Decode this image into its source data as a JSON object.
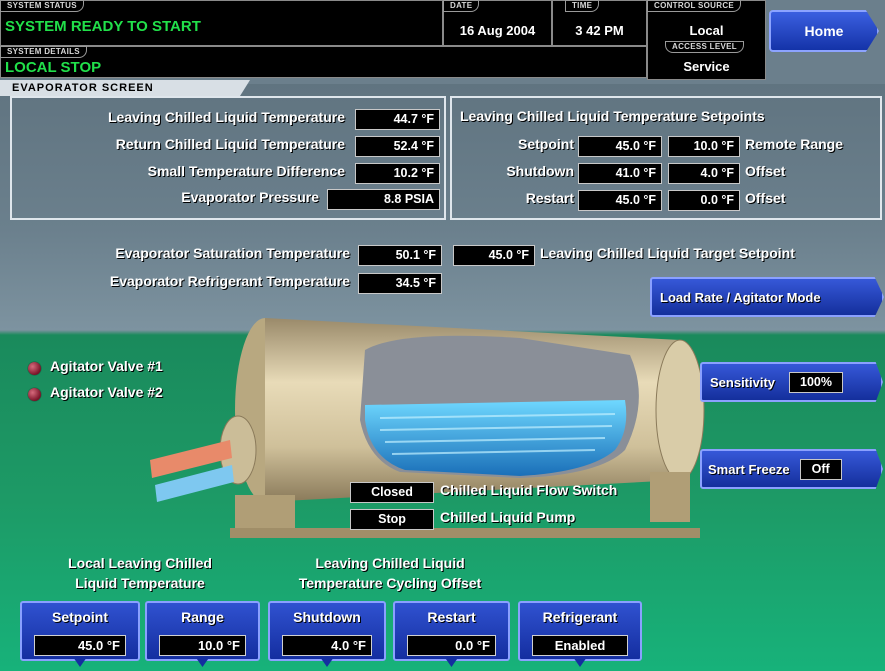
{
  "header": {
    "system_status_tab": "SYSTEM STATUS",
    "system_status": "SYSTEM READY TO START",
    "system_details_tab": "SYSTEM DETAILS",
    "system_details": "LOCAL STOP",
    "date_tab": "DATE",
    "date": "16 Aug 2004",
    "time_tab": "TIME",
    "time": "3 42 PM",
    "control_source_tab": "CONTROL SOURCE",
    "control_source": "Local",
    "access_level_tab": "ACCESS LEVEL",
    "access_level": "Service",
    "home_label": "Home"
  },
  "screen_title": "EVAPORATOR SCREEN",
  "left_panel": {
    "rows": [
      {
        "label": "Leaving Chilled Liquid Temperature",
        "value": "44.7 °F"
      },
      {
        "label": "Return Chilled Liquid Temperature",
        "value": "52.4 °F"
      },
      {
        "label": "Small Temperature Difference",
        "value": "10.2 °F"
      },
      {
        "label": "Evaporator Pressure",
        "value": "8.8 PSIA"
      }
    ]
  },
  "right_panel": {
    "title": "Leaving Chilled Liquid Temperature Setpoints",
    "rows": [
      {
        "label": "Setpoint",
        "value": "45.0 °F",
        "value2": "10.0 °F",
        "suffix": "Remote Range"
      },
      {
        "label": "Shutdown",
        "value": "41.0 °F",
        "value2": "4.0 °F",
        "suffix": "Offset"
      },
      {
        "label": "Restart",
        "value": "45.0 °F",
        "value2": "0.0 °F",
        "suffix": "Offset"
      }
    ]
  },
  "saturation": {
    "label": "Evaporator Saturation Temperature",
    "value": "50.1 °F"
  },
  "refrigerant_temp": {
    "label": "Evaporator Refrigerant Temperature",
    "value": "34.5 °F"
  },
  "target_setpoint": {
    "value": "45.0 °F",
    "label": "Leaving Chilled Liquid Target Setpoint"
  },
  "load_rate_button": "Load Rate / Agitator Mode",
  "agitators": [
    {
      "label": "Agitator Valve #1"
    },
    {
      "label": "Agitator Valve #2"
    }
  ],
  "sensitivity": {
    "label": "Sensitivity",
    "value": "100%"
  },
  "smart_freeze": {
    "label": "Smart Freeze",
    "value": "Off"
  },
  "flow_switch": {
    "state": "Closed",
    "label": "Chilled Liquid Flow Switch"
  },
  "pump": {
    "state": "Stop",
    "label": "Chilled Liquid Pump"
  },
  "captions": {
    "local_line1": "Local Leaving Chilled",
    "local_line2": "Liquid Temperature",
    "cycling_line1": "Leaving Chilled Liquid",
    "cycling_line2": "Temperature Cycling Offset"
  },
  "bottom_buttons": [
    {
      "label": "Setpoint",
      "value": "45.0 °F"
    },
    {
      "label": "Range",
      "value": "10.0 °F"
    },
    {
      "label": "Shutdown",
      "value": "4.0 °F"
    },
    {
      "label": "Restart",
      "value": "0.0 °F"
    },
    {
      "label": "Refrigerant",
      "value": "Enabled"
    }
  ],
  "colors": {
    "status_green": "#21e04a",
    "button_blue": "#1a3bb8",
    "led_red": "#8a1a30"
  }
}
